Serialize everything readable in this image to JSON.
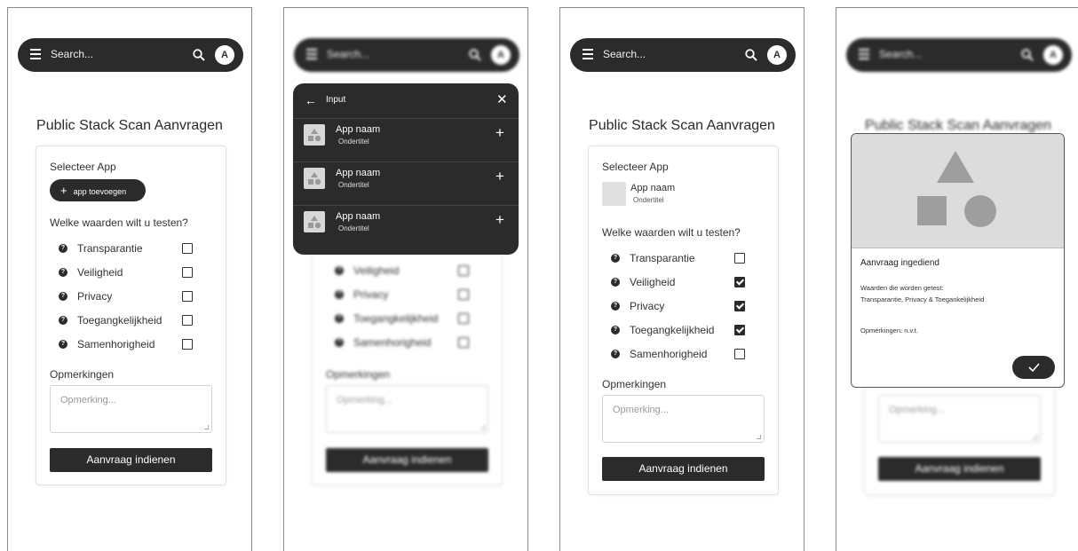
{
  "search": {
    "placeholder": "Search...",
    "avatar": "A"
  },
  "page": {
    "title": "Public Stack Scan Aanvragen"
  },
  "form": {
    "select_app_label": "Selecteer App",
    "add_app_label": "app toevoegen",
    "values_question": "Welke waarden wilt u testen?",
    "options": [
      {
        "label": "Transparantie"
      },
      {
        "label": "Veiligheid"
      },
      {
        "label": "Privacy"
      },
      {
        "label": "Toegangkelijkheid"
      },
      {
        "label": "Samenhorigheid"
      }
    ],
    "remarks_label": "Opmerkingen",
    "remarks_placeholder": "Opmerking...",
    "submit_label": "Aanvraag indienen"
  },
  "screens": [
    {
      "checked": [
        false,
        false,
        false,
        false,
        false
      ]
    },
    {
      "checked": [
        false,
        false,
        false,
        false,
        false
      ]
    },
    {
      "checked": [
        false,
        true,
        true,
        true,
        false
      ]
    },
    {
      "checked": [
        false,
        false,
        false,
        false,
        false
      ]
    }
  ],
  "app_picker": {
    "input_value": "Input",
    "items": [
      {
        "name": "App naam",
        "subtitle": "Ondertitel"
      },
      {
        "name": "App naam",
        "subtitle": "Ondertitel"
      },
      {
        "name": "App naam",
        "subtitle": "Ondertitel"
      }
    ]
  },
  "selected_app": {
    "name": "App naam",
    "subtitle": "Ondertitel"
  },
  "confirmation": {
    "title": "Aanvraag ingediend",
    "tested_label": "Waarden die worden getest:",
    "tested_values": "Transparantie, Privacy & Toegankelijkheid",
    "remarks": "Opmerkingen: n.v.t."
  },
  "colors": {
    "primary": "#2b2b2b",
    "placeholder_gray": "#dcdcdc"
  }
}
